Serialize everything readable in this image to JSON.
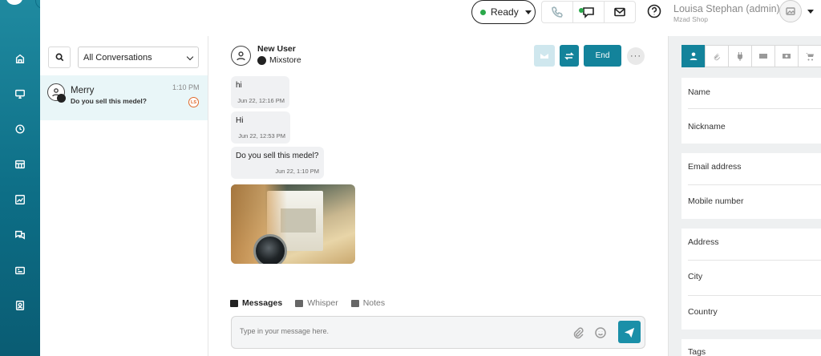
{
  "topbar": {
    "status_label": "Ready",
    "user_name": "Louisa Stephan (admin)",
    "user_shop": "Mzad Shop"
  },
  "conversations": {
    "filter_label": "All Conversations",
    "items": [
      {
        "name": "Merry",
        "preview": "Do you sell this medel?",
        "time": "1:10 PM",
        "badge": "LS"
      }
    ]
  },
  "chat": {
    "user_name": "New User",
    "channel": "Mixstore",
    "end_label": "End",
    "more_label": "···",
    "messages": [
      {
        "text": "hi",
        "time": "Jun 22, 12:16 PM"
      },
      {
        "text": "Hi",
        "time": "Jun 22, 12:53 PM"
      },
      {
        "text": "Do you sell this medel?",
        "time": "Jun 22, 1:10 PM"
      }
    ],
    "tabs": [
      {
        "label": "Messages",
        "active": true
      },
      {
        "label": "Whisper",
        "active": false
      },
      {
        "label": "Notes",
        "active": false
      }
    ],
    "composer_placeholder": "Type in your message here."
  },
  "details": {
    "fields": [
      "Name",
      "Nickname",
      "Email address",
      "Mobile number",
      "Address",
      "City",
      "Country",
      "Tags"
    ]
  },
  "icons": {
    "rail": [
      "home-icon",
      "monitor-icon",
      "clock-icon",
      "dashboard-icon",
      "analytics-icon",
      "messages-icon",
      "ticket-icon",
      "contact-card-icon"
    ],
    "right_tabs": [
      "user-icon",
      "attachment-icon",
      "plugin-icon",
      "credit-card-icon",
      "camera-icon",
      "cart-icon"
    ]
  },
  "colors": {
    "brand": "#13839b",
    "rail_top": "#1f8aa0",
    "rail_bottom": "#0a5c73",
    "online": "#2aa84a",
    "badge": "#e06a2c"
  }
}
